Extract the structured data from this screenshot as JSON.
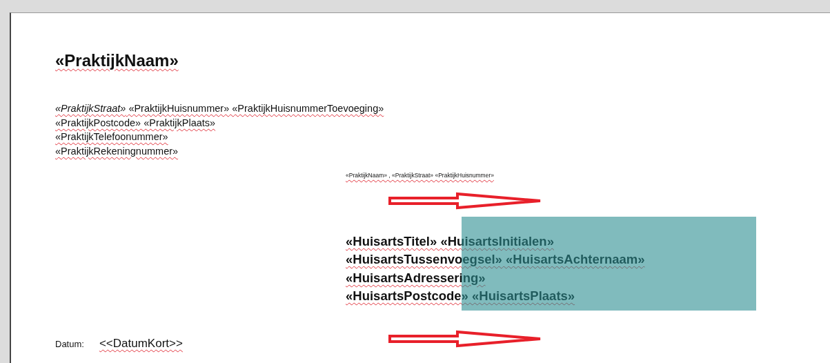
{
  "document": {
    "practice_name": "«PraktijkNaam»",
    "address_lines": [
      "*«PraktijkStraat»* «PraktijkHuisnummer» «PraktijkHuisnummerToevoeging»",
      "«PraktijkPostcode» «PraktijkPlaats»",
      "«PraktijkTelefoonummer»",
      "«PraktijkRekeningnummer»"
    ],
    "sender_line": "«PraktijkNaam» , «PraktijkStraat» «PraktijkHuisnummer»",
    "recipient_lines": [
      "«HuisartsTitel» «HuisartsInitialen»",
      "«HuisartsTussenvoegsel» «HuisartsAchternaam»",
      "«HuisartsAdressering»",
      "«HuisartsPostcode» «HuisartsPlaats»"
    ],
    "date_label": "Datum:",
    "date_value": "<<DatumKort>>"
  }
}
